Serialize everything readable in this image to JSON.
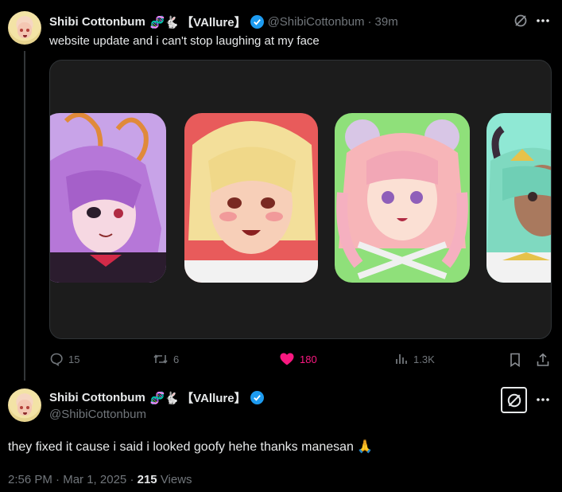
{
  "tweet": {
    "author_name": "Shibi Cottonbum",
    "author_emoji": "🧬🐇",
    "author_tag": "【VAllure】",
    "handle": "@ShibiCottonbum",
    "separator": "·",
    "time_ago": "39m",
    "text": "website update and i can't stop laughing at my face",
    "stats": {
      "replies": "15",
      "reposts": "6",
      "likes": "180",
      "views": "1.3K"
    }
  },
  "reply": {
    "author_name": "Shibi Cottonbum",
    "author_emoji": "🧬🐇",
    "author_tag": "【VAllure】",
    "handle": "@ShibiCottonbum",
    "text": "they fixed it cause i said i looked goofy hehe thanks manesan 🙏",
    "time": "2:56 PM",
    "date": "Mar 1, 2025",
    "separator": "·",
    "views_count": "215",
    "views_label": "Views"
  },
  "colors": {
    "background": "#000000",
    "text": "#e7e9ea",
    "muted": "#71767b",
    "verified": "#1d9bf0",
    "like": "#f91880"
  },
  "icons": [
    "grok-icon",
    "more-icon",
    "reply-icon",
    "repost-icon",
    "like-icon",
    "views-icon",
    "bookmark-icon",
    "share-icon",
    "verified-icon"
  ]
}
